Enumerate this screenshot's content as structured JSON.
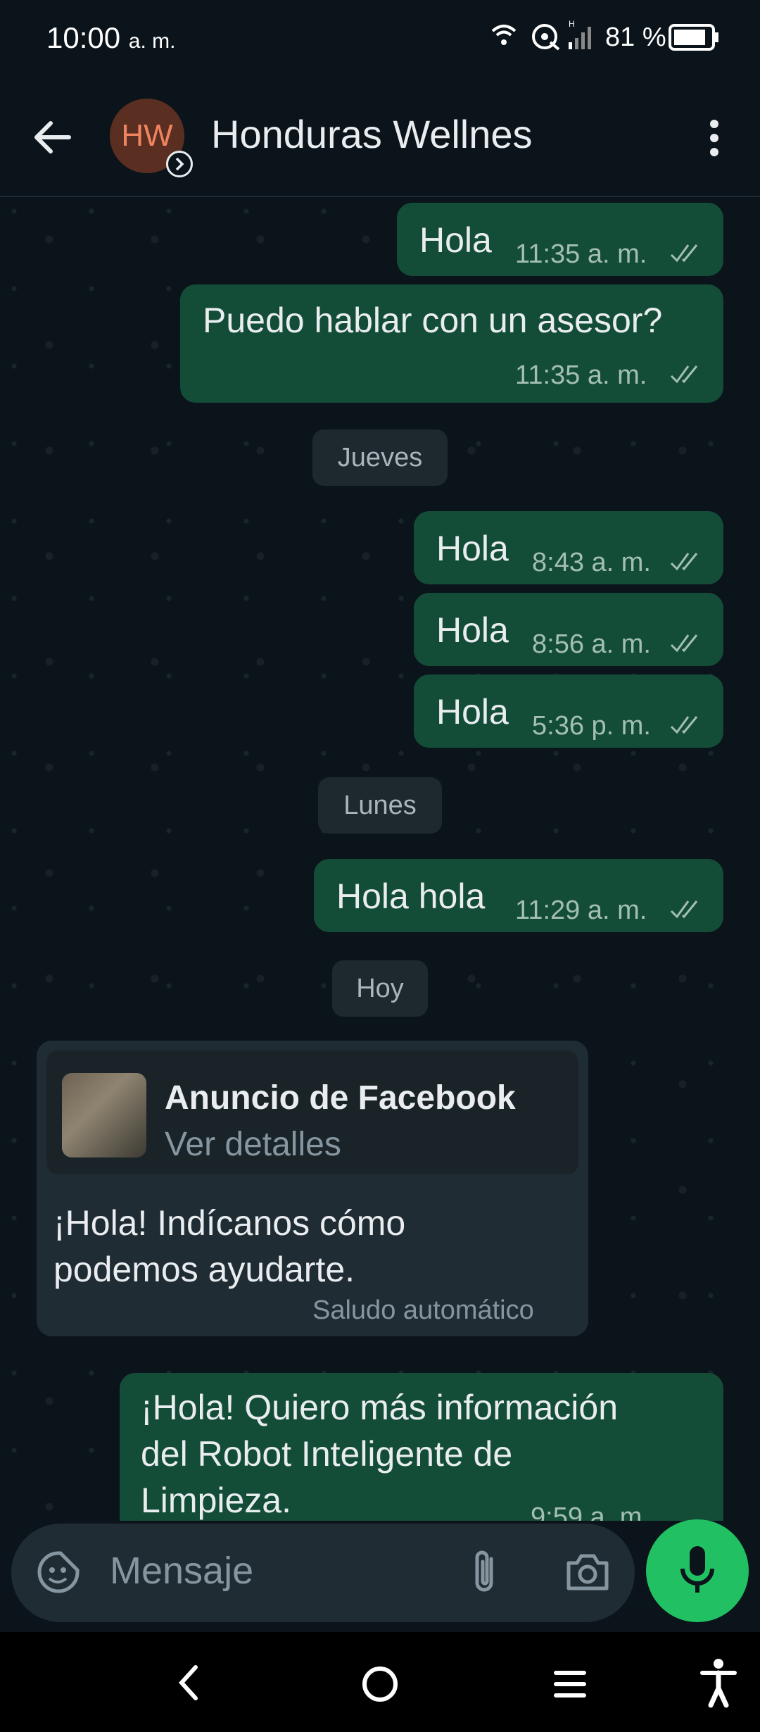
{
  "status_bar": {
    "time": "10:00",
    "ampm": "a. m.",
    "battery": "81 %"
  },
  "header": {
    "avatar_initials": "HW",
    "contact_name": "Honduras Wellnes"
  },
  "messages": {
    "m1": {
      "text": "Hola",
      "time": "11:35 a. m."
    },
    "m2": {
      "text": "Puedo hablar con un asesor?",
      "time": "11:35 a. m."
    },
    "date1": "Jueves",
    "m3": {
      "text": "Hola",
      "time": "8:43 a. m."
    },
    "m4": {
      "text": "Hola",
      "time": "8:56 a. m."
    },
    "m5": {
      "text": "Hola",
      "time": "5:36 p. m."
    },
    "date2": "Lunes",
    "m6": {
      "text": "Hola hola",
      "time": "11:29 a. m."
    },
    "date3": "Hoy",
    "ad": {
      "title": "Anuncio de Facebook",
      "subtitle": "Ver detalles",
      "line1": "¡Hola! Indícanos cómo",
      "line2": "podemos ayudarte.",
      "footer": "Saludo automático"
    },
    "m7": {
      "line1": "¡Hola! Quiero más información",
      "line2": "del Robot Inteligente de",
      "line3": "Limpieza.",
      "time": "9:59 a. m."
    }
  },
  "input": {
    "placeholder": "Mensaje"
  },
  "colors": {
    "outgoing_bubble": "#144d37",
    "incoming_bubble": "#202c33",
    "mic_button": "#21c063",
    "background": "#0b141a"
  }
}
